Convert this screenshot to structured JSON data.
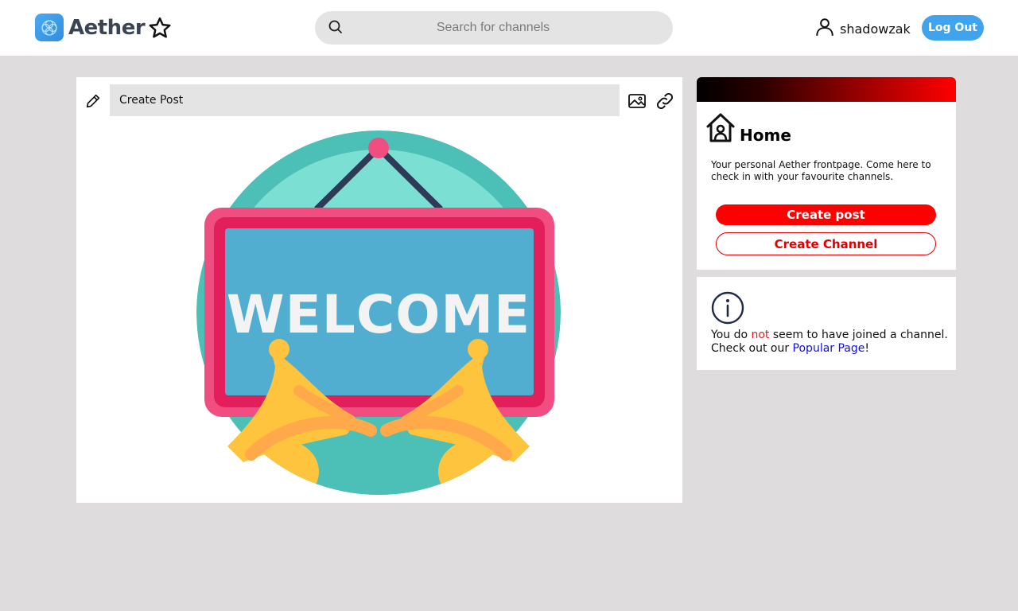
{
  "header": {
    "logo_text": "Aether",
    "logo_icon": "aether-logo-icon",
    "favorite_icon": "star-icon",
    "search": {
      "placeholder": "Search for channels",
      "value": "",
      "icon": "search-icon"
    },
    "user": {
      "name": "shadowzak",
      "icon": "user-icon"
    },
    "logout_label": "Log Out"
  },
  "post_panel": {
    "create_post_label": "Create Post",
    "icons": [
      "pencil-icon",
      "image-icon",
      "link-icon"
    ],
    "art_text": "WELCOME"
  },
  "sidebar": {
    "home": {
      "title": "Home",
      "description": "Your personal Aether frontpage. Come here to check in with your favourite channels.",
      "create_post_label": "Create post",
      "create_channel_label": "Create Channel"
    },
    "info": {
      "text_before": "You do ",
      "text_highlight": "not",
      "text_after": " seem to have joined a channel. Check out our ",
      "link_label": "Popular Page",
      "text_end": "!"
    }
  },
  "colors": {
    "accent_blue": "#3fa3ee",
    "accent_red": "#ff0000",
    "background": "#dedcdc"
  }
}
